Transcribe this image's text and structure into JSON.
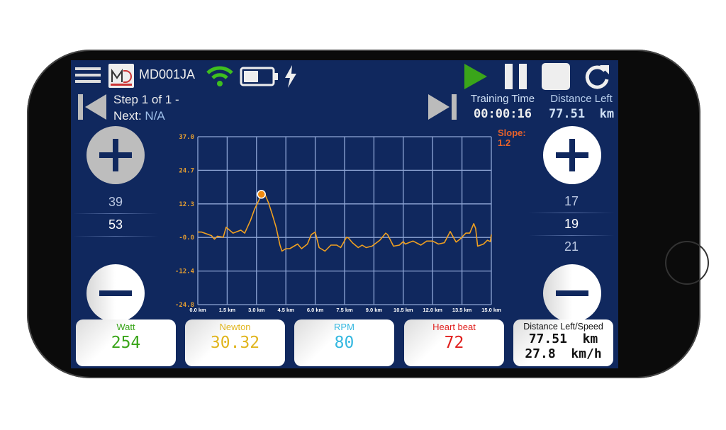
{
  "header": {
    "device_name": "MD001JA",
    "logo_text": "MAGNETICDAYS",
    "icons": [
      "menu-icon",
      "wifi-icon",
      "battery-icon",
      "charging-bolt-icon",
      "play-icon",
      "pause-icon",
      "stop-icon",
      "refresh-icon"
    ],
    "wifi_color": "#3fbf1f",
    "play_color": "#3aa51a"
  },
  "step": {
    "line1": "Step 1 of 1 -",
    "next_label": "Next:",
    "next_value": "N/A"
  },
  "training_time": {
    "label": "Training Time",
    "value": "00:00:16"
  },
  "distance_left": {
    "label": "Distance Left",
    "value": "77.51  km"
  },
  "slope": {
    "label": "Slope:",
    "value": "1.2",
    "color": "#e8622a"
  },
  "left_picker": {
    "values": [
      "39",
      "53"
    ],
    "selected": "53"
  },
  "right_picker": {
    "values": [
      "17",
      "19",
      "21"
    ],
    "selected": "19"
  },
  "cards": [
    {
      "title": "Watt",
      "value": "254",
      "color": "#3aa51a"
    },
    {
      "title": "Newton",
      "value": "30.32",
      "color": "#e0b51e"
    },
    {
      "title": "RPM",
      "value": "80",
      "color": "#35b8e0"
    },
    {
      "title": "Heart beat",
      "value": "72",
      "color": "#e0201e"
    }
  ],
  "distance_speed": {
    "title": "Distance Left/Speed",
    "distance": "77.51  km",
    "speed": "27.8  km/h"
  },
  "chart_data": {
    "type": "line",
    "title": "",
    "xlabel": "",
    "ylabel": "",
    "xlim": [
      0,
      15
    ],
    "ylim": [
      -24.8,
      37.0
    ],
    "x_ticks": [
      "0.0 km",
      "1.5 km",
      "3.0 km",
      "4.5 km",
      "6.0 km",
      "7.5 km",
      "9.0 km",
      "10.5 km",
      "12.0 km",
      "13.5 km",
      "15.0 km"
    ],
    "y_ticks": [
      "37.0",
      "24.7",
      "12.3",
      "-0.0",
      "-12.4",
      "-24.8"
    ],
    "grid": true,
    "line_color": "#f0a020",
    "grid_color": "#8fa6d6",
    "marker": {
      "x": 3.25,
      "y": 15.8
    },
    "x": [
      0,
      0.2,
      0.7,
      0.85,
      1.0,
      1.3,
      1.45,
      1.8,
      2.2,
      2.4,
      2.7,
      2.9,
      3.1,
      3.25,
      3.45,
      3.6,
      3.8,
      4.0,
      4.2,
      4.3,
      4.5,
      4.7,
      5.1,
      5.3,
      5.6,
      5.8,
      6.0,
      6.2,
      6.5,
      6.8,
      7.1,
      7.3,
      7.6,
      7.7,
      7.9,
      8.2,
      8.4,
      8.6,
      8.9,
      9.3,
      9.6,
      9.7,
      10.0,
      10.3,
      10.5,
      10.6,
      11.0,
      11.4,
      11.7,
      12.0,
      12.3,
      12.6,
      12.9,
      13.2,
      13.4,
      13.7,
      13.9,
      14.1,
      14.2,
      14.3,
      14.6,
      14.8,
      14.95,
      15
    ],
    "y": [
      1.9,
      1.9,
      0.6,
      -0.7,
      0.4,
      0,
      3.7,
      1.5,
      2.6,
      1.5,
      6.3,
      10.3,
      13.3,
      15.8,
      15.5,
      12.9,
      8.5,
      3.7,
      -2.9,
      -5.1,
      -4.2,
      -4.2,
      -2.5,
      -4.2,
      -2.5,
      1.0,
      1.9,
      -3.8,
      -5.1,
      -2.9,
      -2.9,
      -3.8,
      0,
      -0.3,
      -2,
      -3.8,
      -2.9,
      -3.8,
      -3.3,
      -1.1,
      1.5,
      1.0,
      -3.3,
      -2.9,
      -1.6,
      -2.5,
      -1.4,
      -2.9,
      -1.4,
      -1.4,
      -2.5,
      -2,
      2.1,
      -1.8,
      -0.7,
      1.5,
      1.5,
      5.0,
      3.2,
      -3.3,
      -2.5,
      -1.1,
      -1.6,
      1.0
    ]
  }
}
